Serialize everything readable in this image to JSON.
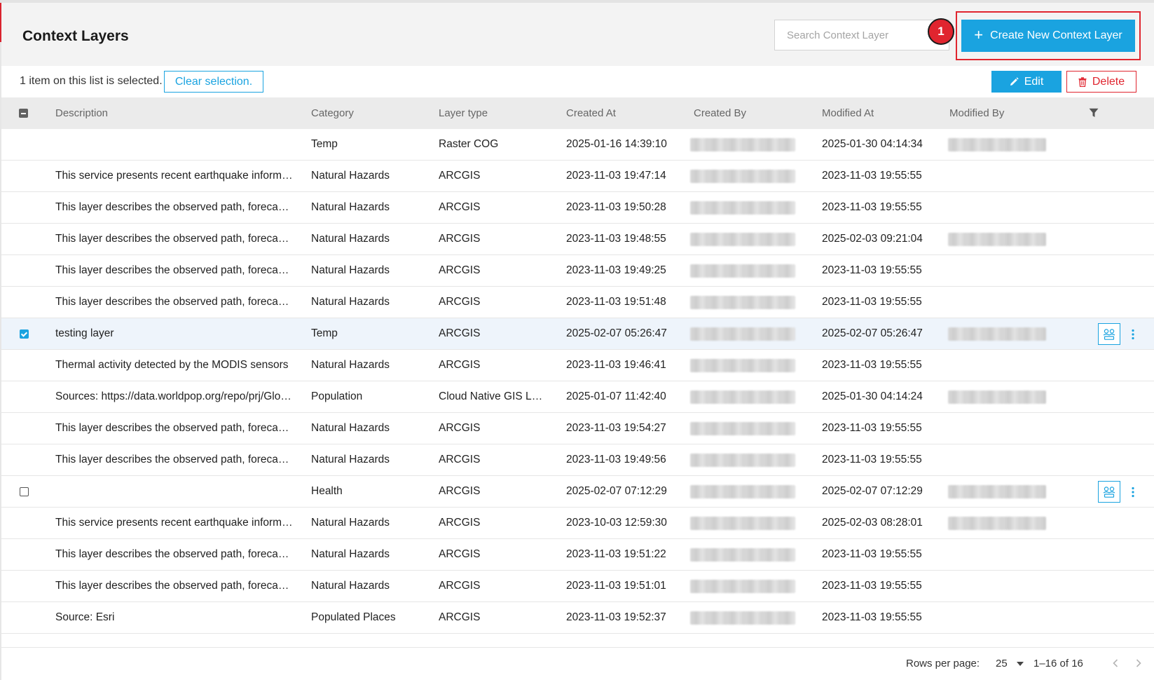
{
  "header": {
    "title": "Context Layers",
    "search_placeholder": "Search Context Layer",
    "create_label": "Create New Context Layer",
    "step_badge": "1"
  },
  "toolbar": {
    "selection_text": "1 item on this list is selected.",
    "clear_label": "Clear selection.",
    "edit_label": "Edit",
    "delete_label": "Delete"
  },
  "columns": [
    "Description",
    "Category",
    "Layer type",
    "Created At",
    "Created By",
    "Modified At",
    "Modified By"
  ],
  "rows": [
    {
      "description": "",
      "category": "Temp",
      "layer_type": "Raster COG",
      "created_at": "2025-01-16 14:39:10",
      "modified_at": "2025-01-30 04:14:34",
      "modified_by_shown": true,
      "checkbox": "none",
      "actions": false
    },
    {
      "description": "This service presents recent earthquake information from the USGS Prompt Assessment of Global Earthquakes for Response",
      "category": "Natural Hazards",
      "layer_type": "ARCGIS",
      "created_at": "2023-11-03 19:47:14",
      "modified_at": "2023-11-03 19:55:55",
      "modified_by_shown": false,
      "checkbox": "none",
      "actions": false
    },
    {
      "description": "This layer describes the observed path, forecast path and forecast cone",
      "category": "Natural Hazards",
      "layer_type": "ARCGIS",
      "created_at": "2023-11-03 19:50:28",
      "modified_at": "2023-11-03 19:55:55",
      "modified_by_shown": false,
      "checkbox": "none",
      "actions": false
    },
    {
      "description": "This layer describes the observed path, forecast path and forecast cone",
      "category": "Natural Hazards",
      "layer_type": "ARCGIS",
      "created_at": "2023-11-03 19:48:55",
      "modified_at": "2025-02-03 09:21:04",
      "modified_by_shown": true,
      "checkbox": "none",
      "actions": false
    },
    {
      "description": "This layer describes the observed path, forecast path and forecast cone",
      "category": "Natural Hazards",
      "layer_type": "ARCGIS",
      "created_at": "2023-11-03 19:49:25",
      "modified_at": "2023-11-03 19:55:55",
      "modified_by_shown": false,
      "checkbox": "none",
      "actions": false
    },
    {
      "description": "This layer describes the observed path, forecast path and forecast cone",
      "category": "Natural Hazards",
      "layer_type": "ARCGIS",
      "created_at": "2023-11-03 19:51:48",
      "modified_at": "2023-11-03 19:55:55",
      "modified_by_shown": false,
      "checkbox": "none",
      "actions": false
    },
    {
      "description": "testing layer",
      "category": "Temp",
      "layer_type": "ARCGIS",
      "created_at": "2025-02-07 05:26:47",
      "modified_at": "2025-02-07 05:26:47",
      "modified_by_shown": true,
      "checkbox": "checked",
      "actions": true
    },
    {
      "description": "Thermal activity detected by the MODIS sensors",
      "category": "Natural Hazards",
      "layer_type": "ARCGIS",
      "created_at": "2023-11-03 19:46:41",
      "modified_at": "2023-11-03 19:55:55",
      "modified_by_shown": false,
      "checkbox": "none",
      "actions": false
    },
    {
      "description": "Sources: https://data.worldpop.org/repo/prj/Global",
      "category": "Population",
      "layer_type": "Cloud Native GIS Layer",
      "created_at": "2025-01-07 11:42:40",
      "modified_at": "2025-01-30 04:14:24",
      "modified_by_shown": true,
      "checkbox": "none",
      "actions": false
    },
    {
      "description": "This layer describes the observed path, forecast path and forecast cone",
      "category": "Natural Hazards",
      "layer_type": "ARCGIS",
      "created_at": "2023-11-03 19:54:27",
      "modified_at": "2023-11-03 19:55:55",
      "modified_by_shown": false,
      "checkbox": "none",
      "actions": false
    },
    {
      "description": "This layer describes the observed path, forecast path and forecast cone",
      "category": "Natural Hazards",
      "layer_type": "ARCGIS",
      "created_at": "2023-11-03 19:49:56",
      "modified_at": "2023-11-03 19:55:55",
      "modified_by_shown": false,
      "checkbox": "none",
      "actions": false
    },
    {
      "description": "",
      "category": "Health",
      "layer_type": "ARCGIS",
      "created_at": "2025-02-07 07:12:29",
      "modified_at": "2025-02-07 07:12:29",
      "modified_by_shown": true,
      "checkbox": "unchecked",
      "actions": true
    },
    {
      "description": "This service presents recent earthquake information from the USGS Prompt Assessment of Global Earthquakes for Response",
      "category": "Natural Hazards",
      "layer_type": "ARCGIS",
      "created_at": "2023-10-03 12:59:30",
      "modified_at": "2025-02-03 08:28:01",
      "modified_by_shown": true,
      "checkbox": "none",
      "actions": false
    },
    {
      "description": "This layer describes the observed path, forecast path and forecast cone",
      "category": "Natural Hazards",
      "layer_type": "ARCGIS",
      "created_at": "2023-11-03 19:51:22",
      "modified_at": "2023-11-03 19:55:55",
      "modified_by_shown": false,
      "checkbox": "none",
      "actions": false
    },
    {
      "description": "This layer describes the observed path, forecast path and forecast cone",
      "category": "Natural Hazards",
      "layer_type": "ARCGIS",
      "created_at": "2023-11-03 19:51:01",
      "modified_at": "2023-11-03 19:55:55",
      "modified_by_shown": false,
      "checkbox": "none",
      "actions": false
    },
    {
      "description": "Source: Esri",
      "category": "Populated Places",
      "layer_type": "ARCGIS",
      "created_at": "2023-11-03 19:52:37",
      "modified_at": "2023-11-03 19:55:55",
      "modified_by_shown": false,
      "checkbox": "none",
      "actions": false
    }
  ],
  "pagination": {
    "rows_per_page_label": "Rows per page:",
    "rows_per_page": "25",
    "range": "1–16 of 16"
  },
  "icons": {
    "create": "plus-icon",
    "edit": "pencil-icon",
    "delete": "trash-icon",
    "filter": "filter-icon",
    "share": "share-users-icon",
    "more": "more-vertical-icon",
    "prev": "chevron-left-icon",
    "next": "chevron-right-icon"
  },
  "colors": {
    "accent": "#1aa3e0",
    "danger": "#e0252f",
    "selected_row": "#eef4fb"
  }
}
